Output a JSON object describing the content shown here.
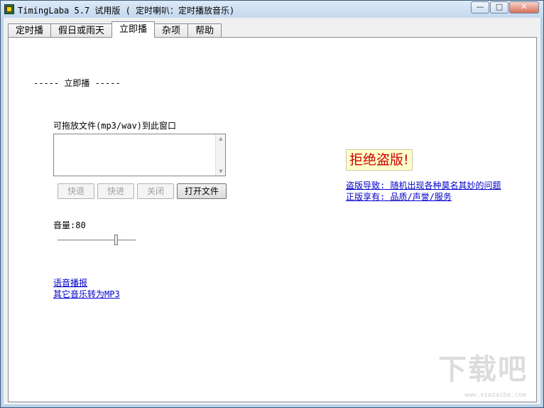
{
  "window": {
    "title": "TimingLaba 5.7 试用版 ( 定时喇叭：定时播放音乐)",
    "minimize_label": "—",
    "maximize_label": "□",
    "close_label": "✕"
  },
  "tabs": [
    {
      "label": "定时播",
      "active": false
    },
    {
      "label": "假日或雨天",
      "active": false
    },
    {
      "label": "立即播",
      "active": true
    },
    {
      "label": "杂项",
      "active": false
    },
    {
      "label": "帮助",
      "active": false
    }
  ],
  "main": {
    "section_heading": "----- 立即播 -----",
    "drop_label": "可拖放文件(mp3/wav)到此窗口",
    "buttons": {
      "rewind": "快退",
      "forward": "快进",
      "close": "关闭",
      "open_file": "打开文件"
    },
    "volume_label": "音量:80",
    "volume_value": 80,
    "links": {
      "voice_announce": "语音播报",
      "convert_mp3": "其它音乐转为MP3"
    }
  },
  "promo": {
    "banner": "拒绝盗版!",
    "piracy_warning": "盗版导致: 随机出现各种莫名其妙的问题",
    "genuine_benefits": "正版享有: 品质/声誉/服务"
  },
  "watermark": {
    "text": "下载吧",
    "url": "www.xiazaiba.com"
  },
  "colors": {
    "link": "#0000cc",
    "banner_text": "#cc0000",
    "banner_bg": "#ffffcc"
  }
}
